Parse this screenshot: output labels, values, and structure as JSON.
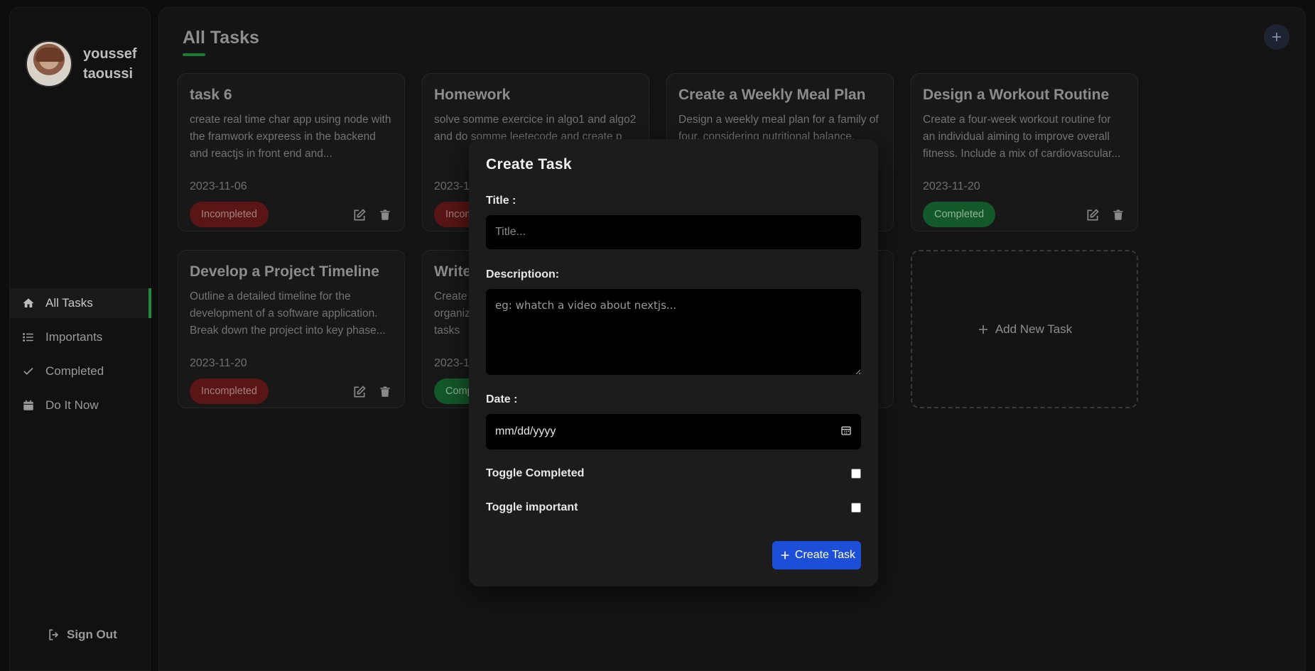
{
  "user": {
    "first_name": "youssef",
    "last_name": "taoussi"
  },
  "sidebar": {
    "items": [
      {
        "label": "All Tasks",
        "icon": "home-icon",
        "active": true
      },
      {
        "label": "Importants",
        "icon": "list-icon"
      },
      {
        "label": "Completed",
        "icon": "check-icon"
      },
      {
        "label": "Do It Now",
        "icon": "calendar-icon"
      }
    ],
    "sign_out": "Sign Out"
  },
  "main": {
    "title": "All Tasks",
    "add_new_task": "Add New Task",
    "tasks": [
      {
        "title": "task 6",
        "description": "create real time char app using node with the framwork expreess in the backend and reactjs in front end and...",
        "date": "2023-11-06",
        "status": "Incompleted"
      },
      {
        "title": "Homework",
        "description": "solve somme exercice in algo1 and algo2 and do somme leetecode and create p",
        "date": "2023-1",
        "status": "Incom"
      },
      {
        "title": "Create a Weekly Meal Plan",
        "description": "Design a weekly meal plan for a family of four, considering nutritional balance,",
        "date": "",
        "status": ""
      },
      {
        "title": "Design a Workout Routine",
        "description": "Create a four-week workout routine for an individual aiming to improve overall fitness. Include a mix of cardiovascular...",
        "date": "2023-11-20",
        "status": "Completed"
      },
      {
        "title": "Develop a Project Timeline",
        "description": "Outline a detailed timeline for the development of a software application. Break down the project into key phase...",
        "date": "2023-11-20",
        "status": "Incompleted"
      },
      {
        "title": "Write",
        "description": "Create organiz tasks su",
        "date": "2023-1",
        "status": "Comp"
      }
    ]
  },
  "modal": {
    "title": "Create Task",
    "title_label": "Title :",
    "title_placeholder": "Title...",
    "description_label": "Descriptioon:",
    "description_placeholder": "eg: whatch a video about nextjs...",
    "date_label": "Date :",
    "date_placeholder": "mm/dd/yyyy",
    "toggle_completed": "Toggle Completed",
    "toggle_important": "Toggle important",
    "create_button": "Create Task"
  },
  "colors": {
    "accent_green": "#1f8a3a",
    "incomplete_red": "#5a1515",
    "complete_green": "#14592a",
    "primary_blue": "#1d4ed8"
  }
}
